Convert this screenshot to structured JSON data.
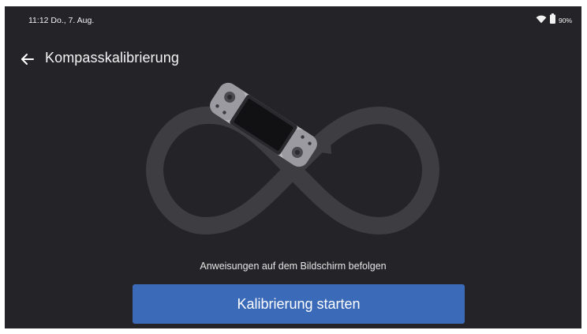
{
  "status_bar": {
    "time_date": "11:12  Do., 7. Aug.",
    "battery_percent": "90%",
    "wifi_icon": "wifi-icon",
    "battery_icon": "battery-icon"
  },
  "nav": {
    "back_icon": "arrow-left-icon",
    "title": "Kompasskalibrierung"
  },
  "content": {
    "instruction": "Anweisungen auf dem Bildschirm befolgen",
    "start_button_label": "Kalibrierung starten"
  },
  "colors": {
    "background": "#242428",
    "infinity_path": "#3e3e42",
    "accent_button": "#3a6ab8",
    "text": "#ffffff"
  }
}
